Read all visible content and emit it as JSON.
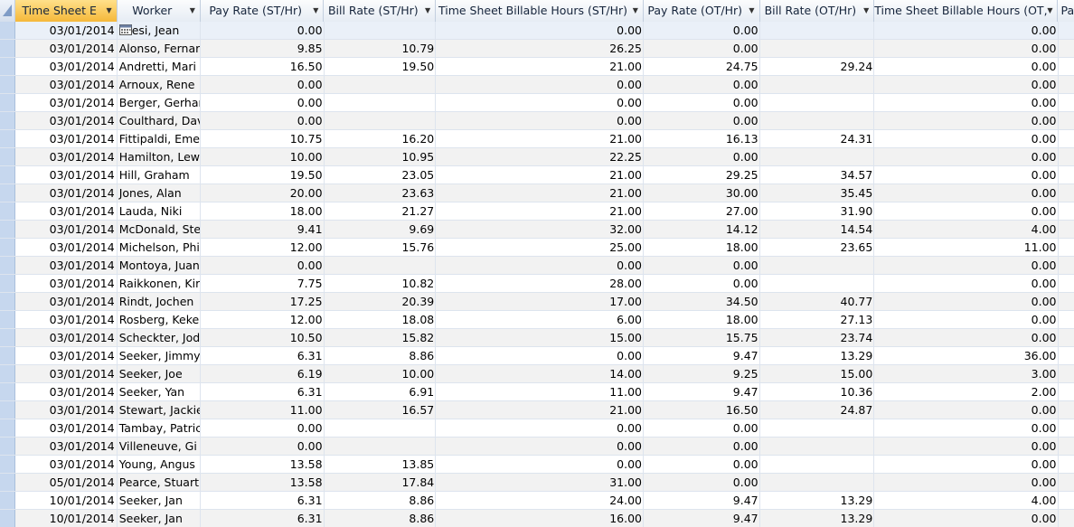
{
  "columns": [
    {
      "label": "Time Sheet E"
    },
    {
      "label": "Worker"
    },
    {
      "label": "Pay Rate (ST/Hr)"
    },
    {
      "label": "Bill Rate (ST/Hr)"
    },
    {
      "label": "Time Sheet Billable Hours (ST/Hr)"
    },
    {
      "label": "Pay Rate (OT/Hr)"
    },
    {
      "label": "Bill Rate (OT/Hr)"
    },
    {
      "label": "Time Sheet Billable Hours (OT,"
    },
    {
      "label": "Pa"
    }
  ],
  "rows": [
    {
      "date": "03/01/2014",
      "worker": "esi, Jean",
      "pay_st": "0.00",
      "bill_st": "",
      "hours_st": "0.00",
      "pay_ot": "0.00",
      "bill_ot": "",
      "hours_ot": "0.00"
    },
    {
      "date": "03/01/2014",
      "worker": "Alonso, Fernar",
      "pay_st": "9.85",
      "bill_st": "10.79",
      "hours_st": "26.25",
      "pay_ot": "0.00",
      "bill_ot": "",
      "hours_ot": "0.00"
    },
    {
      "date": "03/01/2014",
      "worker": "Andretti, Mari",
      "pay_st": "16.50",
      "bill_st": "19.50",
      "hours_st": "21.00",
      "pay_ot": "24.75",
      "bill_ot": "29.24",
      "hours_ot": "0.00"
    },
    {
      "date": "03/01/2014",
      "worker": "Arnoux, Rene",
      "pay_st": "0.00",
      "bill_st": "",
      "hours_st": "0.00",
      "pay_ot": "0.00",
      "bill_ot": "",
      "hours_ot": "0.00"
    },
    {
      "date": "03/01/2014",
      "worker": "Berger, Gerhar",
      "pay_st": "0.00",
      "bill_st": "",
      "hours_st": "0.00",
      "pay_ot": "0.00",
      "bill_ot": "",
      "hours_ot": "0.00"
    },
    {
      "date": "03/01/2014",
      "worker": "Coulthard, Dav",
      "pay_st": "0.00",
      "bill_st": "",
      "hours_st": "0.00",
      "pay_ot": "0.00",
      "bill_ot": "",
      "hours_ot": "0.00"
    },
    {
      "date": "03/01/2014",
      "worker": "Fittipaldi, Eme",
      "pay_st": "10.75",
      "bill_st": "16.20",
      "hours_st": "21.00",
      "pay_ot": "16.13",
      "bill_ot": "24.31",
      "hours_ot": "0.00"
    },
    {
      "date": "03/01/2014",
      "worker": "Hamilton, Lew",
      "pay_st": "10.00",
      "bill_st": "10.95",
      "hours_st": "22.25",
      "pay_ot": "0.00",
      "bill_ot": "",
      "hours_ot": "0.00"
    },
    {
      "date": "03/01/2014",
      "worker": "Hill, Graham",
      "pay_st": "19.50",
      "bill_st": "23.05",
      "hours_st": "21.00",
      "pay_ot": "29.25",
      "bill_ot": "34.57",
      "hours_ot": "0.00"
    },
    {
      "date": "03/01/2014",
      "worker": "Jones, Alan",
      "pay_st": "20.00",
      "bill_st": "23.63",
      "hours_st": "21.00",
      "pay_ot": "30.00",
      "bill_ot": "35.45",
      "hours_ot": "0.00"
    },
    {
      "date": "03/01/2014",
      "worker": "Lauda, Niki",
      "pay_st": "18.00",
      "bill_st": "21.27",
      "hours_st": "21.00",
      "pay_ot": "27.00",
      "bill_ot": "31.90",
      "hours_ot": "0.00"
    },
    {
      "date": "03/01/2014",
      "worker": "McDonald, Ste",
      "pay_st": "9.41",
      "bill_st": "9.69",
      "hours_st": "32.00",
      "pay_ot": "14.12",
      "bill_ot": "14.54",
      "hours_ot": "4.00"
    },
    {
      "date": "03/01/2014",
      "worker": "Michelson, Phi",
      "pay_st": "12.00",
      "bill_st": "15.76",
      "hours_st": "25.00",
      "pay_ot": "18.00",
      "bill_ot": "23.65",
      "hours_ot": "11.00"
    },
    {
      "date": "03/01/2014",
      "worker": "Montoya, Juan",
      "pay_st": "0.00",
      "bill_st": "",
      "hours_st": "0.00",
      "pay_ot": "0.00",
      "bill_ot": "",
      "hours_ot": "0.00"
    },
    {
      "date": "03/01/2014",
      "worker": "Raikkonen, Kir",
      "pay_st": "7.75",
      "bill_st": "10.82",
      "hours_st": "28.00",
      "pay_ot": "0.00",
      "bill_ot": "",
      "hours_ot": "0.00"
    },
    {
      "date": "03/01/2014",
      "worker": "Rindt, Jochen",
      "pay_st": "17.25",
      "bill_st": "20.39",
      "hours_st": "17.00",
      "pay_ot": "34.50",
      "bill_ot": "40.77",
      "hours_ot": "0.00"
    },
    {
      "date": "03/01/2014",
      "worker": "Rosberg, Keke",
      "pay_st": "12.00",
      "bill_st": "18.08",
      "hours_st": "6.00",
      "pay_ot": "18.00",
      "bill_ot": "27.13",
      "hours_ot": "0.00"
    },
    {
      "date": "03/01/2014",
      "worker": "Scheckter, Jod",
      "pay_st": "10.50",
      "bill_st": "15.82",
      "hours_st": "15.00",
      "pay_ot": "15.75",
      "bill_ot": "23.74",
      "hours_ot": "0.00"
    },
    {
      "date": "03/01/2014",
      "worker": "Seeker, Jimmy",
      "pay_st": "6.31",
      "bill_st": "8.86",
      "hours_st": "0.00",
      "pay_ot": "9.47",
      "bill_ot": "13.29",
      "hours_ot": "36.00"
    },
    {
      "date": "03/01/2014",
      "worker": "Seeker, Joe",
      "pay_st": "6.19",
      "bill_st": "10.00",
      "hours_st": "14.00",
      "pay_ot": "9.25",
      "bill_ot": "15.00",
      "hours_ot": "3.00"
    },
    {
      "date": "03/01/2014",
      "worker": "Seeker, Yan",
      "pay_st": "6.31",
      "bill_st": "6.91",
      "hours_st": "11.00",
      "pay_ot": "9.47",
      "bill_ot": "10.36",
      "hours_ot": "2.00"
    },
    {
      "date": "03/01/2014",
      "worker": "Stewart, Jackie",
      "pay_st": "11.00",
      "bill_st": "16.57",
      "hours_st": "21.00",
      "pay_ot": "16.50",
      "bill_ot": "24.87",
      "hours_ot": "0.00"
    },
    {
      "date": "03/01/2014",
      "worker": "Tambay, Patric",
      "pay_st": "0.00",
      "bill_st": "",
      "hours_st": "0.00",
      "pay_ot": "0.00",
      "bill_ot": "",
      "hours_ot": "0.00"
    },
    {
      "date": "03/01/2014",
      "worker": "Villeneuve, Gi",
      "pay_st": "0.00",
      "bill_st": "",
      "hours_st": "0.00",
      "pay_ot": "0.00",
      "bill_ot": "",
      "hours_ot": "0.00"
    },
    {
      "date": "03/01/2014",
      "worker": "Young, Angus",
      "pay_st": "13.58",
      "bill_st": "13.85",
      "hours_st": "0.00",
      "pay_ot": "0.00",
      "bill_ot": "",
      "hours_ot": "0.00"
    },
    {
      "date": "05/01/2014",
      "worker": "Pearce, Stuart",
      "pay_st": "13.58",
      "bill_st": "17.84",
      "hours_st": "31.00",
      "pay_ot": "0.00",
      "bill_ot": "",
      "hours_ot": "0.00"
    },
    {
      "date": "10/01/2014",
      "worker": "Seeker, Jan",
      "pay_st": "6.31",
      "bill_st": "8.86",
      "hours_st": "24.00",
      "pay_ot": "9.47",
      "bill_ot": "13.29",
      "hours_ot": "4.00"
    },
    {
      "date": "10/01/2014",
      "worker": "Seeker, Jan",
      "pay_st": "6.31",
      "bill_st": "8.86",
      "hours_st": "16.00",
      "pay_ot": "9.47",
      "bill_ot": "13.29",
      "hours_ot": "0.00"
    }
  ],
  "colors": {
    "selected_header": "#f5b83a",
    "selector_column": "#c6d7ee",
    "alt_row": "#f2f2f2"
  },
  "icons": {
    "date_picker": "calendar-icon",
    "sort": "chevron-down-icon",
    "select_all": "select-all-corner-icon"
  }
}
